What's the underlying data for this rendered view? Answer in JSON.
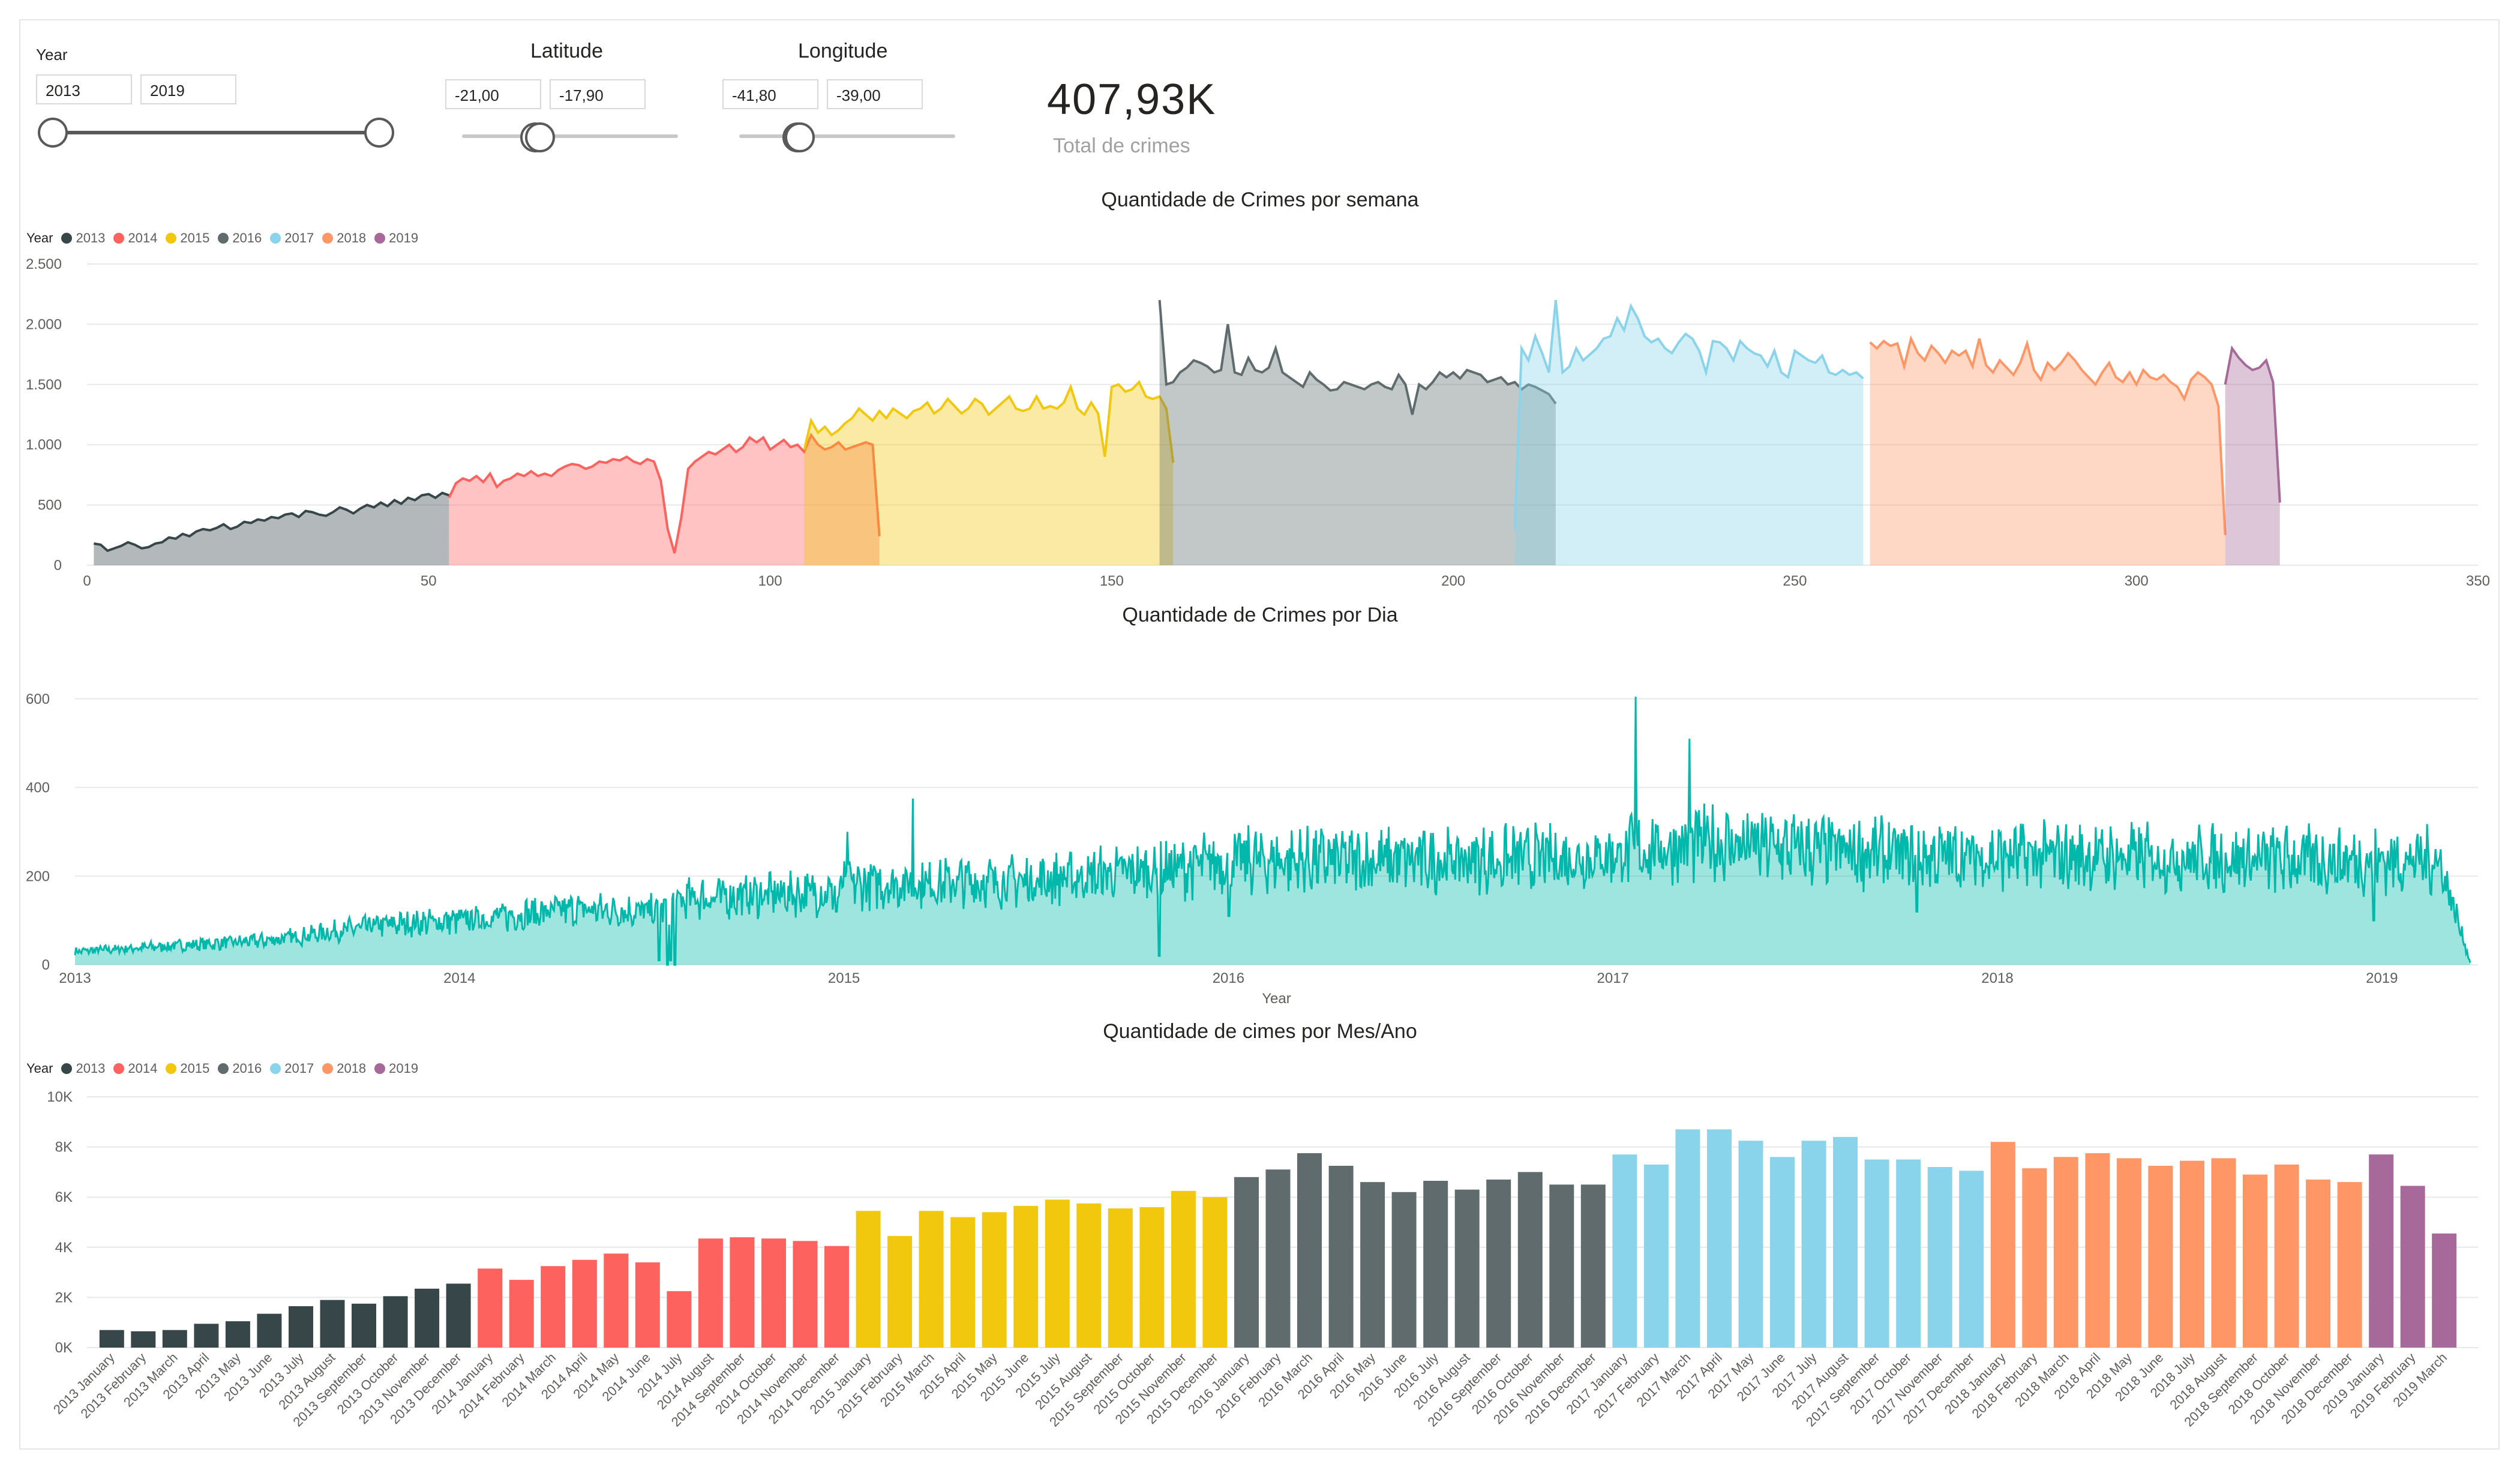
{
  "filters": {
    "year": {
      "title": "Year",
      "min_value": "2013",
      "max_value": "2019",
      "selection": [
        0,
        1
      ]
    },
    "latitude": {
      "title": "Latitude",
      "min_value": "-21,00",
      "max_value": "-17,90",
      "selection": [
        0.34,
        0.36
      ]
    },
    "longitude": {
      "title": "Longitude",
      "min_value": "-41,80",
      "max_value": "-39,00",
      "selection": [
        0.27,
        0.28
      ]
    }
  },
  "kpi": {
    "value": "407,93K",
    "label": "Total de crimes"
  },
  "legend": {
    "title": "Year",
    "items": [
      {
        "label": "2013",
        "color": "#374649"
      },
      {
        "label": "2014",
        "color": "#FD625E"
      },
      {
        "label": "2015",
        "color": "#F2C80F"
      },
      {
        "label": "2016",
        "color": "#5F6B6D"
      },
      {
        "label": "2017",
        "color": "#8AD4EB"
      },
      {
        "label": "2018",
        "color": "#FE9666"
      },
      {
        "label": "2019",
        "color": "#A66999"
      }
    ]
  },
  "chart_data": [
    {
      "type": "area",
      "title": "Quantidade de Crimes por semana",
      "legend_placement": "top-left",
      "grid": true,
      "x_ticks": [
        "0",
        "50",
        "100",
        "150",
        "200",
        "250",
        "300",
        "350"
      ],
      "y_ticks": [
        "0",
        "500",
        "1.000",
        "1.500",
        "2.000",
        "2.500"
      ],
      "xlim": [
        0,
        350
      ],
      "ylim": [
        0,
        2500
      ],
      "series": [
        {
          "name": "2013",
          "x_start": 1,
          "values": [
            180,
            170,
            120,
            140,
            160,
            190,
            170,
            140,
            150,
            180,
            190,
            230,
            220,
            260,
            240,
            280,
            300,
            290,
            310,
            340,
            300,
            320,
            360,
            350,
            380,
            370,
            400,
            390,
            420,
            430,
            400,
            450,
            440,
            420,
            410,
            440,
            480,
            460,
            430,
            470,
            500,
            480,
            520,
            490,
            540,
            510,
            560,
            540,
            580,
            590,
            560,
            600,
            580
          ]
        },
        {
          "name": "2014",
          "x_start": 53,
          "values": [
            560,
            680,
            720,
            700,
            740,
            690,
            760,
            650,
            700,
            720,
            760,
            740,
            780,
            740,
            760,
            740,
            790,
            820,
            840,
            830,
            800,
            820,
            860,
            850,
            880,
            870,
            900,
            860,
            840,
            880,
            860,
            700,
            300,
            100,
            400,
            800,
            860,
            900,
            940,
            920,
            960,
            1000,
            940,
            980,
            1060,
            1020,
            1060,
            960,
            1000,
            1040,
            980,
            1000,
            940,
            1080,
            1000,
            960,
            980,
            1020,
            960,
            980,
            1000,
            1020,
            1000,
            240
          ]
        },
        {
          "name": "2015",
          "x_start": 105,
          "values": [
            960,
            1200,
            1100,
            1150,
            1080,
            1120,
            1180,
            1220,
            1300,
            1250,
            1200,
            1280,
            1220,
            1300,
            1260,
            1220,
            1280,
            1300,
            1350,
            1260,
            1300,
            1380,
            1320,
            1260,
            1300,
            1380,
            1340,
            1250,
            1300,
            1350,
            1400,
            1300,
            1280,
            1300,
            1400,
            1300,
            1320,
            1300,
            1350,
            1480,
            1300,
            1250,
            1350,
            1260,
            900,
            1480,
            1500,
            1440,
            1460,
            1520,
            1400,
            1380,
            1400,
            1300,
            850
          ]
        },
        {
          "name": "2016",
          "x_start": 157,
          "values": [
            2200,
            1500,
            1520,
            1600,
            1640,
            1700,
            1680,
            1650,
            1600,
            1620,
            2000,
            1600,
            1580,
            1720,
            1620,
            1600,
            1640,
            1800,
            1600,
            1560,
            1520,
            1480,
            1600,
            1540,
            1500,
            1450,
            1460,
            1520,
            1500,
            1480,
            1460,
            1500,
            1520,
            1480,
            1460,
            1580,
            1500,
            1250,
            1500,
            1460,
            1520,
            1600,
            1560,
            1600,
            1550,
            1620,
            1600,
            1580,
            1520,
            1540,
            1560,
            1500,
            1520,
            1460,
            1500,
            1480,
            1450,
            1420,
            1340
          ]
        },
        {
          "name": "2017",
          "x_start": 209,
          "values": [
            300,
            1800,
            1700,
            1900,
            1760,
            1600,
            2200,
            1600,
            1650,
            1800,
            1700,
            1750,
            1800,
            1880,
            1900,
            2050,
            1950,
            2150,
            2050,
            1900,
            1850,
            1880,
            1800,
            1760,
            1850,
            1920,
            1880,
            1780,
            1600,
            1860,
            1850,
            1800,
            1700,
            1860,
            1800,
            1760,
            1740,
            1650,
            1780,
            1600,
            1560,
            1780,
            1740,
            1700,
            1680,
            1740,
            1600,
            1580,
            1620,
            1580,
            1600,
            1550
          ]
        },
        {
          "name": "2018",
          "x_start": 261,
          "values": [
            1850,
            1800,
            1860,
            1820,
            1840,
            1650,
            1880,
            1760,
            1700,
            1820,
            1760,
            1680,
            1780,
            1740,
            1780,
            1650,
            1880,
            1660,
            1600,
            1700,
            1640,
            1580,
            1680,
            1840,
            1620,
            1540,
            1680,
            1620,
            1680,
            1760,
            1700,
            1620,
            1560,
            1500,
            1600,
            1680,
            1560,
            1520,
            1600,
            1500,
            1620,
            1560,
            1540,
            1580,
            1520,
            1480,
            1380,
            1540,
            1600,
            1560,
            1500,
            1320,
            250
          ]
        },
        {
          "name": "2019",
          "x_start": 313,
          "values": [
            1500,
            1800,
            1720,
            1660,
            1620,
            1640,
            1700,
            1520,
            520
          ]
        }
      ]
    },
    {
      "type": "area",
      "title": "Quantidade de Crimes por Dia",
      "xlabel": "Year",
      "grid": true,
      "x_ticks": [
        "2013",
        "2014",
        "2015",
        "2016",
        "2017",
        "2018",
        "2019"
      ],
      "y_ticks": [
        "0",
        "200",
        "400",
        "600"
      ],
      "xlim": [
        2013,
        2019.25
      ],
      "ylim": [
        0,
        620
      ],
      "color": "#01B8AA",
      "anchors": [
        [
          2013.0,
          30
        ],
        [
          2013.5,
          55
        ],
        [
          2013.8,
          90
        ],
        [
          2014.0,
          100
        ],
        [
          2014.3,
          125
        ],
        [
          2014.5,
          120
        ],
        [
          2014.6,
          150
        ],
        [
          2014.99,
          165
        ],
        [
          2015.0,
          180
        ],
        [
          2015.5,
          190
        ],
        [
          2015.9,
          220
        ],
        [
          2016.0,
          235
        ],
        [
          2016.5,
          235
        ],
        [
          2016.9,
          240
        ],
        [
          2017.1,
          260
        ],
        [
          2017.25,
          275
        ],
        [
          2017.5,
          260
        ],
        [
          2017.8,
          245
        ],
        [
          2018.0,
          245
        ],
        [
          2018.5,
          240
        ],
        [
          2018.9,
          235
        ],
        [
          2019.15,
          235
        ],
        [
          2019.23,
          5
        ]
      ],
      "dips": [
        [
          2014.52,
          10
        ],
        [
          2014.54,
          0
        ],
        [
          2014.55,
          10
        ],
        [
          2014.56,
          0
        ],
        [
          2014.98,
          120
        ],
        [
          2015.82,
          20
        ],
        [
          2016.0,
          110
        ],
        [
          2017.79,
          120
        ],
        [
          2018.98,
          100
        ]
      ],
      "spikes": [
        [
          2015.01,
          300
        ],
        [
          2015.18,
          375
        ],
        [
          2017.06,
          605
        ],
        [
          2017.2,
          510
        ],
        [
          2016.7,
          240
        ]
      ]
    },
    {
      "type": "bar",
      "title": "Quantidade de cimes por Mes/Ano",
      "legend_placement": "top-left",
      "grid": true,
      "y_ticks": [
        "0K",
        "2K",
        "4K",
        "6K",
        "8K",
        "10K"
      ],
      "ylim": [
        0,
        10000
      ],
      "categories": [
        "2013 January",
        "2013 February",
        "2013 March",
        "2013 April",
        "2013 May",
        "2013 June",
        "2013 July",
        "2013 August",
        "2013 September",
        "2013 October",
        "2013 November",
        "2013 December",
        "2014 January",
        "2014 February",
        "2014 March",
        "2014 April",
        "2014 May",
        "2014 June",
        "2014 July",
        "2014 August",
        "2014 September",
        "2014 October",
        "2014 November",
        "2014 December",
        "2015 January",
        "2015 February",
        "2015 March",
        "2015 April",
        "2015 May",
        "2015 June",
        "2015 July",
        "2015 August",
        "2015 September",
        "2015 October",
        "2015 November",
        "2015 December",
        "2016 January",
        "2016 February",
        "2016 March",
        "2016 April",
        "2016 May",
        "2016 June",
        "2016 July",
        "2016 August",
        "2016 September",
        "2016 October",
        "2016 November",
        "2016 December",
        "2017 January",
        "2017 February",
        "2017 March",
        "2017 April",
        "2017 May",
        "2017 June",
        "2017 July",
        "2017 August",
        "2017 September",
        "2017 October",
        "2017 November",
        "2017 December",
        "2018 January",
        "2018 February",
        "2018 March",
        "2018 April",
        "2018 May",
        "2018 June",
        "2018 July",
        "2018 August",
        "2018 September",
        "2018 October",
        "2018 November",
        "2018 December",
        "2019 January",
        "2019 February",
        "2019 March"
      ],
      "values": [
        700,
        650,
        700,
        950,
        1050,
        1350,
        1650,
        1900,
        1750,
        2050,
        2350,
        2550,
        3150,
        2700,
        3250,
        3500,
        3750,
        3400,
        2250,
        4350,
        4400,
        4350,
        4250,
        4050,
        5450,
        4450,
        5450,
        5200,
        5400,
        5650,
        5900,
        5750,
        5550,
        5600,
        6250,
        6000,
        6800,
        7100,
        7750,
        7250,
        6600,
        6200,
        6650,
        6300,
        6700,
        7000,
        6500,
        6500,
        7700,
        7300,
        8700,
        8700,
        8250,
        7600,
        8250,
        8400,
        7500,
        7500,
        7200,
        7050,
        8200,
        7150,
        7600,
        7750,
        7550,
        7250,
        7450,
        7550,
        6900,
        7300,
        6700,
        6600,
        7700,
        6450,
        4550
      ],
      "category_year": [
        0,
        0,
        0,
        0,
        0,
        0,
        0,
        0,
        0,
        0,
        0,
        0,
        1,
        1,
        1,
        1,
        1,
        1,
        1,
        1,
        1,
        1,
        1,
        1,
        2,
        2,
        2,
        2,
        2,
        2,
        2,
        2,
        2,
        2,
        2,
        2,
        3,
        3,
        3,
        3,
        3,
        3,
        3,
        3,
        3,
        3,
        3,
        3,
        4,
        4,
        4,
        4,
        4,
        4,
        4,
        4,
        4,
        4,
        4,
        4,
        5,
        5,
        5,
        5,
        5,
        5,
        5,
        5,
        5,
        5,
        5,
        5,
        6,
        6,
        6
      ]
    }
  ]
}
